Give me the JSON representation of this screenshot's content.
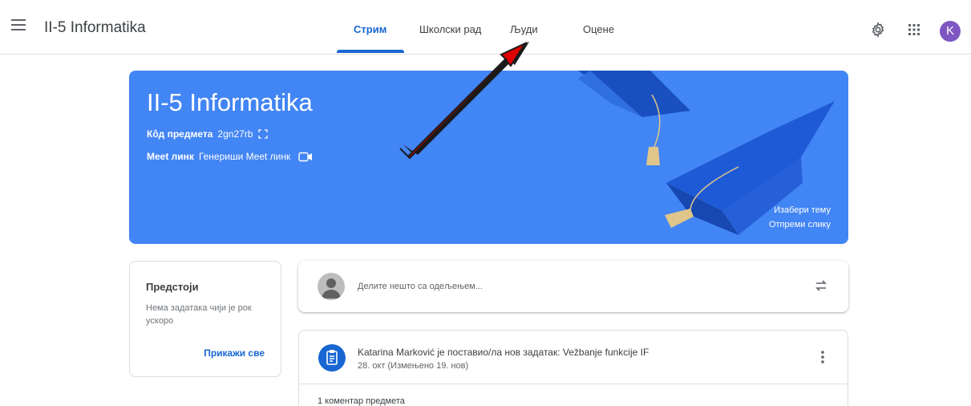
{
  "header": {
    "title": "II-5 Informatika",
    "tabs": [
      {
        "label": "Стрим",
        "active": true
      },
      {
        "label": "Школски рад",
        "active": false
      },
      {
        "label": "Људи",
        "active": false
      },
      {
        "label": "Оцене",
        "active": false
      }
    ],
    "avatar_letter": "K",
    "icons": [
      "menu-icon",
      "gear-icon",
      "apps-icon"
    ]
  },
  "banner": {
    "title": "II-5 Informatika",
    "class_code_label": "Кôд предмета",
    "class_code": "2gn27rb",
    "meet_label": "Meet линк",
    "meet_value": "Генериши Meet линк",
    "choose_theme": "Изабери тему",
    "upload_photo": "Отпреми слику",
    "color": "#4285f4"
  },
  "upcoming": {
    "title": "Предстоји",
    "text": "Нема задатака чији је рок ускоро",
    "view_all": "Прикажи све"
  },
  "share": {
    "placeholder": "Делите нешто са одељењем..."
  },
  "post": {
    "title": "Katarina Marković је поставио/ла нов задатак: Vežbanje funkcije IF",
    "date": "28. окт (Измењено 19. нов)",
    "comments": "1 коментар предмета"
  },
  "colors": {
    "accent": "#1967d2",
    "annotation_arrow": "#e00000"
  }
}
